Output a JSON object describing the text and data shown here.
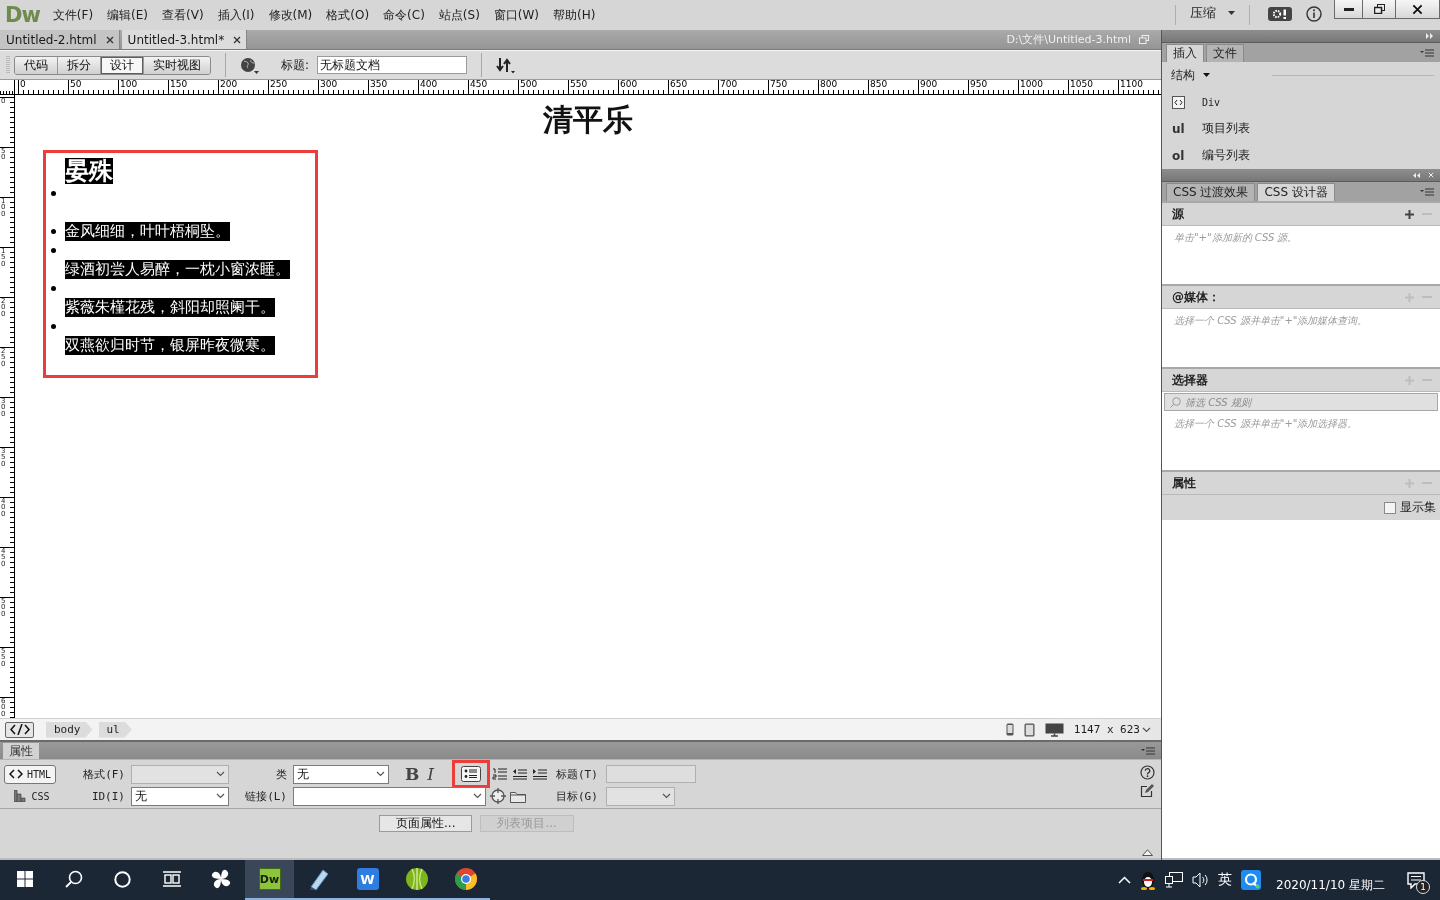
{
  "menu_bar": {
    "logo": "Dw",
    "menu_items": [
      "文件(F)",
      "编辑(E)",
      "查看(V)",
      "插入(I)",
      "修改(M)",
      "格式(O)",
      "命令(C)",
      "站点(S)",
      "窗口(W)",
      "帮助(H)"
    ],
    "workspace": "压缩"
  },
  "document_tabs": [
    {
      "label": "Untitled-2.html",
      "selected": false
    },
    {
      "label": "Untitled-3.html*",
      "selected": true
    }
  ],
  "file_path": "D:\\文件\\Untitled-3.html",
  "document_toolbar": {
    "views": [
      {
        "label": "代码",
        "selected": false
      },
      {
        "label": "拆分",
        "selected": false
      },
      {
        "label": "设计",
        "selected": true
      },
      {
        "label": "实时视图",
        "selected": false
      }
    ],
    "title_label": "标题:",
    "title_value": "无标题文档"
  },
  "ruler": {
    "horizontal_marks": [
      "0",
      "50",
      "100",
      "150",
      "200",
      "250",
      "300",
      "350",
      "400",
      "450",
      "500",
      "550",
      "600",
      "650",
      "700",
      "750",
      "800",
      "850",
      "900",
      "950",
      "1000",
      "1050",
      "1100"
    ],
    "vertical_marks": [
      "0",
      "50",
      "100",
      "150",
      "200",
      "250",
      "300",
      "350",
      "400",
      "450",
      "500",
      "550",
      "600"
    ]
  },
  "document": {
    "title": "清平乐",
    "highlighted": true,
    "heading": {
      "text": "晏殊",
      "selected": true
    },
    "list_items": [
      {
        "kind": "bullet_only"
      },
      {
        "kind": "inline",
        "text": "金风细细，叶叶梧桐坠。",
        "selected": true
      },
      {
        "kind": "below",
        "text": "绿酒初尝人易醉，一枕小窗浓睡。",
        "selected": true
      },
      {
        "kind": "below",
        "text": "紫薇朱槿花残，斜阳却照阑干。",
        "selected": true
      },
      {
        "kind": "below",
        "text": "双燕欲归时节，银屏昨夜微寒。",
        "selected": true
      }
    ]
  },
  "tag_selector": {
    "tags": [
      "body",
      "ul"
    ],
    "window_size": "1147 x 623"
  },
  "properties": {
    "title": "属性",
    "modes": [
      {
        "label": "HTML",
        "selected": true
      },
      {
        "label": "CSS",
        "selected": false
      }
    ],
    "format": {
      "label": "格式(F)",
      "disabled": true
    },
    "id": {
      "label": "ID(I)",
      "value": "无"
    },
    "class": {
      "label": "类",
      "value": "无"
    },
    "link": {
      "label": "链接(L)"
    },
    "text_styles": [
      {
        "kind": "bold",
        "label": "B"
      },
      {
        "kind": "italic",
        "label": "I"
      }
    ],
    "list_tools": [
      {
        "kind": "unordered",
        "pressed": true,
        "highlighted": true
      },
      {
        "kind": "ordered",
        "pressed": false,
        "highlighted": false
      },
      {
        "kind": "outdent",
        "pressed": false,
        "highlighted": false
      },
      {
        "kind": "indent",
        "pressed": false,
        "highlighted": false
      }
    ],
    "title_field": {
      "label": "标题(T)",
      "disabled": true
    },
    "target": {
      "label": "目标(G)",
      "disabled": true
    },
    "buttons": [
      {
        "label": "页面属性...",
        "disabled": false
      },
      {
        "label": "列表项目...",
        "disabled": true
      }
    ]
  },
  "insert_panel": {
    "tabs": [
      {
        "label": "插入",
        "selected": true
      },
      {
        "label": "文件",
        "selected": false
      }
    ],
    "category": "结构",
    "items": [
      {
        "kind": "tag",
        "label": "Div"
      },
      {
        "kind": "abbr",
        "abbr": "ul",
        "label": "项目列表"
      },
      {
        "kind": "abbr",
        "abbr": "ol",
        "label": "编号列表"
      }
    ]
  },
  "css_designer": {
    "tabs": [
      {
        "label": "CSS 过渡效果",
        "selected": false
      },
      {
        "label": "CSS 设计器",
        "selected": true
      }
    ],
    "sections": [
      {
        "title": "源",
        "add_enabled": true,
        "remove_enabled": false,
        "hint": "单击\"+\"添加新的 CSS 源。"
      },
      {
        "title": "@媒体：",
        "add_enabled": false,
        "remove_enabled": false,
        "hint": "选择一个 CSS 源并单击\"+\"添加媒体查询。"
      },
      {
        "title": "选择器",
        "add_enabled": false,
        "remove_enabled": false,
        "filter_placeholder": "筛选 CSS 规则",
        "hint": "选择一个 CSS 源并单击\"+\"添加选择器。"
      },
      {
        "title": "属性",
        "add_enabled": false,
        "remove_enabled": false,
        "show_set": {
          "label": "显示集",
          "checked": false
        }
      }
    ]
  },
  "taskbar": {
    "apps": [
      {
        "kind": "pinwheel",
        "selected": false,
        "running": false
      },
      {
        "kind": "dw",
        "label": "Dw",
        "selected": true,
        "running": true
      },
      {
        "kind": "pen",
        "selected": false,
        "running": true
      },
      {
        "kind": "wps",
        "label": "W",
        "selected": false,
        "running": true
      },
      {
        "kind": "ball",
        "selected": false,
        "running": true
      },
      {
        "kind": "chrome",
        "selected": false,
        "running": true
      }
    ],
    "ime": "英",
    "date": "2020/11/10 星期二",
    "notification_count": "1"
  }
}
